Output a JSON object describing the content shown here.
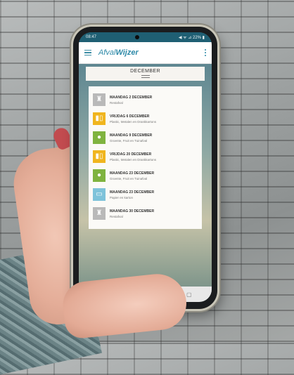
{
  "status_bar": {
    "time": "08:47",
    "right": "◀ ᯤ ⊿ 22% ▮"
  },
  "app": {
    "logo_prefix": "Afval",
    "logo_bold": "Wijzer"
  },
  "month_header": "DECEMBER",
  "pickups": [
    {
      "date": "MAANDAG 2 DECEMBER",
      "stream": "Restafval",
      "color": "#b9b9b9",
      "icon": "trash-bag-icon",
      "glyph": "♜"
    },
    {
      "date": "VRIJDAG 6 DECEMBER",
      "stream": "Plastic, Metalen en Drankkartons",
      "color": "#f0b51e",
      "icon": "bottle-can-icon",
      "glyph": "▮▯"
    },
    {
      "date": "MAANDAG 9 DECEMBER",
      "stream": "Groente, Fruit en Tuinafval",
      "color": "#7fb33f",
      "icon": "apple-icon",
      "glyph": "●"
    },
    {
      "date": "VRIJDAG 20 DECEMBER",
      "stream": "Plastic, Metalen en Drankkartons",
      "color": "#f0b51e",
      "icon": "bottle-can-icon",
      "glyph": "▮▯"
    },
    {
      "date": "MAANDAG 23 DECEMBER",
      "stream": "Groente, Fruit en Tuinafval",
      "color": "#7fb33f",
      "icon": "apple-icon",
      "glyph": "●"
    },
    {
      "date": "MAANDAG 23 DECEMBER",
      "stream": "Papier en karton",
      "color": "#7ec3da",
      "icon": "paper-box-icon",
      "glyph": "▭"
    },
    {
      "date": "MAANDAG 30 DECEMBER",
      "stream": "Restafval",
      "color": "#b9b9b9",
      "icon": "trash-bag-icon",
      "glyph": "♜"
    }
  ],
  "navbar": {
    "back": "◁",
    "home": "○",
    "recent": "▢"
  }
}
